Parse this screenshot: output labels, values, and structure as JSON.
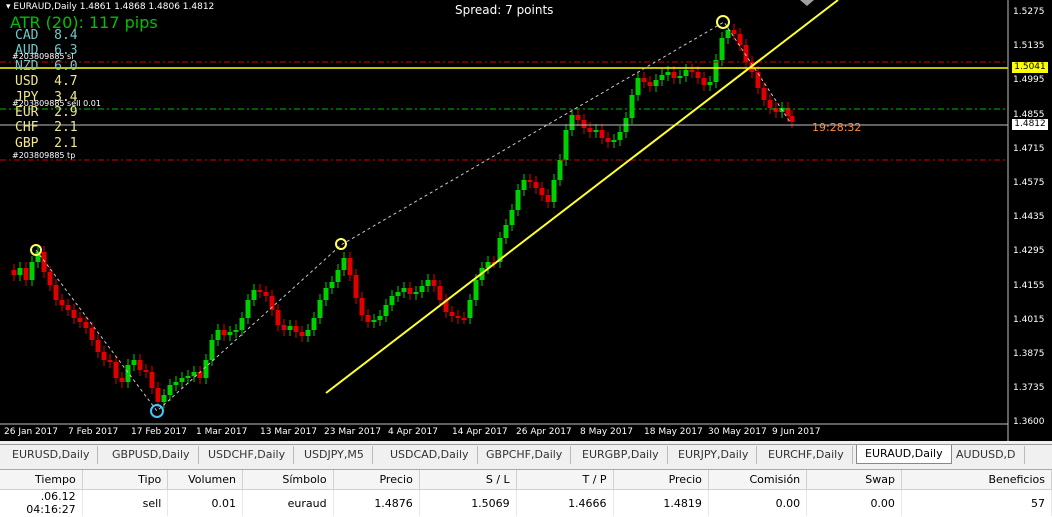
{
  "chart": {
    "header": "EURAUD,Daily  1.4861 1.4868 1.4806 1.4812",
    "spread": "Spread: 7 points",
    "atr": "ATR (20): 117 pips",
    "currencies": [
      {
        "code": "CAD",
        "value": "8.4",
        "color": "#6fc8c8"
      },
      {
        "code": "AUD",
        "value": "6.3",
        "color": "#6fc8c8"
      },
      {
        "code": "NZD",
        "value": "6.0",
        "color": "#6fc8c8"
      },
      {
        "code": "USD",
        "value": "4.7",
        "color": "#f0e68c"
      },
      {
        "code": "JPY",
        "value": "3.4",
        "color": "#f0e68c"
      },
      {
        "code": "EUR",
        "value": "2.9",
        "color": "#f0e68c"
      },
      {
        "code": "CHF",
        "value": "2.1",
        "color": "#f0e68c"
      },
      {
        "code": "GBP",
        "value": "2.1",
        "color": "#f0e68c"
      }
    ],
    "order_labels": {
      "sl": "#203809885 sl",
      "entry": "#203809885 sell 0.01",
      "tp": "#203809885 tp"
    },
    "price_axis": [
      "1.5275",
      "1.5135",
      "1.4995",
      "1.4855",
      "1.4715",
      "1.4575",
      "1.4435",
      "1.4295",
      "1.4155",
      "1.4015",
      "1.3875",
      "1.3735",
      "1.3600"
    ],
    "date_axis": [
      "26 Jan 2017",
      "7 Feb 2017",
      "17 Feb 2017",
      "1 Mar 2017",
      "13 Mar 2017",
      "23 Mar 2017",
      "4 Apr 2017",
      "14 Apr 2017",
      "26 Apr 2017",
      "8 May 2017",
      "18 May 2017",
      "30 May 2017",
      "9 Jun 2017"
    ],
    "sl_price": "1.5041",
    "bid_price": "1.4812",
    "clock": "19:28:32",
    "colors": {
      "bull": "#00d000",
      "bear": "#e00000",
      "trend": "#ffff30",
      "sl": "#ffff00",
      "entry": "#00c000",
      "tp": "#d00000"
    }
  },
  "tabs": [
    "EURUSD,Daily",
    "GBPUSD,Daily",
    "USDCHF,Daily",
    "USDJPY,M5",
    "USDCAD,Daily",
    "GBPCHF,Daily",
    "EURGBP,Daily",
    "EURJPY,Daily",
    "EURCHF,Daily",
    "EURAUD,Daily",
    "AUDUSD,D"
  ],
  "active_tab": "EURAUD,Daily",
  "trades": {
    "columns": [
      "Tiempo",
      "Tipo",
      "Volumen",
      "Símbolo",
      "Precio",
      "S / L",
      "T / P",
      "Precio",
      "Comisión",
      "Swap",
      "Beneficios"
    ],
    "rows": [
      [
        ".06.12 04:16:27",
        "sell",
        "0.01",
        "euraud",
        "1.4876",
        "1.5069",
        "1.4666",
        "1.4819",
        "0.00",
        "0.00",
        "57"
      ]
    ]
  }
}
